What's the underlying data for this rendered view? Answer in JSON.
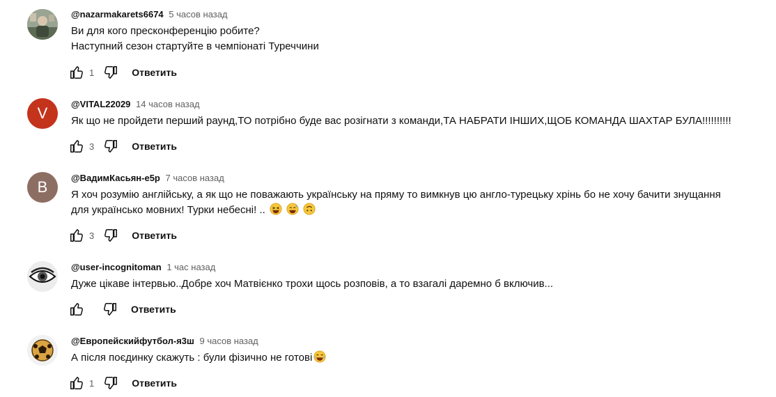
{
  "comments": [
    {
      "author": "@nazarmakarets6674",
      "time": "5 часов назад",
      "lines": [
        "Ви для кого пресконференцію робите?",
        "Наступний сезон стартуйте в чемпіонаті Туреччини"
      ],
      "likes": "1",
      "reply_label": "Ответить",
      "avatar": {
        "type": "photo",
        "colors": [
          "#8a9a8a",
          "#4f5e4e",
          "#c9c2b0"
        ]
      }
    },
    {
      "author": "@VITAL22029",
      "time": "14 часов назад",
      "lines": [
        "Як що не пройдети перший раунд,ТО потрібно буде вас розігнати з команди,ТА НАБРАТИ ІНШИХ,ЩОБ КОМАНДА ШАХТАР БУЛА!!!!!!!!!!"
      ],
      "likes": "3",
      "reply_label": "Ответить",
      "avatar": {
        "type": "letter",
        "letter": "V",
        "color": "#c4331c"
      }
    },
    {
      "author": "@ВадимКасьян-е5р",
      "time": "7 часов назад",
      "lines": [
        "Я хоч розумію англійську, а як що не поважають українську на пряму то вимкнув цю англо-турецьку хрінь бо не хочу бачити знущання",
        "для українсько мовних! Турки небесні! .."
      ],
      "emojis": [
        "laughing-emoji",
        "sweat-smile-emoji",
        "upside-down-face-emoji"
      ],
      "likes": "3",
      "reply_label": "Ответить",
      "avatar": {
        "type": "letter",
        "letter": "B",
        "color": "#8d6e63"
      }
    },
    {
      "author": "@user-incognitoman",
      "time": "1 час назад",
      "lines": [
        "Дуже цікаве інтервью..Добре хоч Матвієнко трохи щось розповів, а то взагалі даремно б включив..."
      ],
      "likes": "",
      "reply_label": "Ответить",
      "avatar": {
        "type": "eye"
      }
    },
    {
      "author": "@Европейскийфутбол-я3ш",
      "time": "9 часов назад",
      "lines": [
        "А після поєдинку скажуть : були фізично не готові"
      ],
      "emojis": [
        "tears-of-joy-emoji"
      ],
      "likes": "1",
      "reply_label": "Ответить",
      "avatar": {
        "type": "ball"
      }
    }
  ],
  "icons": {
    "like": "thumbs-up-icon",
    "dislike": "thumbs-down-icon"
  },
  "colors": {
    "text": "#0f0f0f",
    "secondary": "#606060",
    "background": "#ffffff"
  }
}
